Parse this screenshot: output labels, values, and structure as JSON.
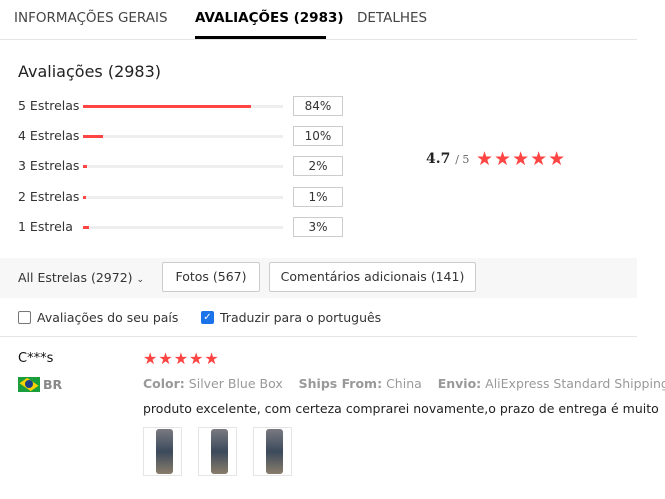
{
  "tabs": [
    {
      "label": "INFORMAÇÕES GERAIS"
    },
    {
      "label": "AVALIAÇÕES (2983)"
    },
    {
      "label": "DETALHES"
    }
  ],
  "summary": {
    "title": "Avaliações (2983)",
    "score": "4.7",
    "out_of": "/ 5",
    "rating": 4.7,
    "rows": [
      {
        "label": "5 Estrelas",
        "percent": "84%",
        "value": 84
      },
      {
        "label": "4 Estrelas",
        "percent": "10%",
        "value": 10
      },
      {
        "label": "3 Estrelas",
        "percent": "2%",
        "value": 2
      },
      {
        "label": "2 Estrelas",
        "percent": "1%",
        "value": 1
      },
      {
        "label": "1 Estrela",
        "percent": "3%",
        "value": 3
      }
    ]
  },
  "filters": {
    "select": "All Estrelas (2972)",
    "photos": "Fotos (567)",
    "comments": "Comentários adicionais (141)",
    "own_country": "Avaliações do seu país",
    "own_country_checked": false,
    "translate": "Traduzir para o português",
    "translate_checked": true
  },
  "review": {
    "name": "C***s",
    "country": "BR",
    "stars": 5,
    "color_label": "Color:",
    "color": "Silver Blue Box",
    "ships_label": "Ships From:",
    "ships": "China",
    "envio_label": "Envio:",
    "envio": "AliExpress Standard Shipping",
    "text": "produto excelente, com certeza comprarei novamente,o prazo de entrega é muito",
    "photos": 3
  },
  "colors": {
    "accent": "#ff4747",
    "tab_active": "#000000"
  }
}
